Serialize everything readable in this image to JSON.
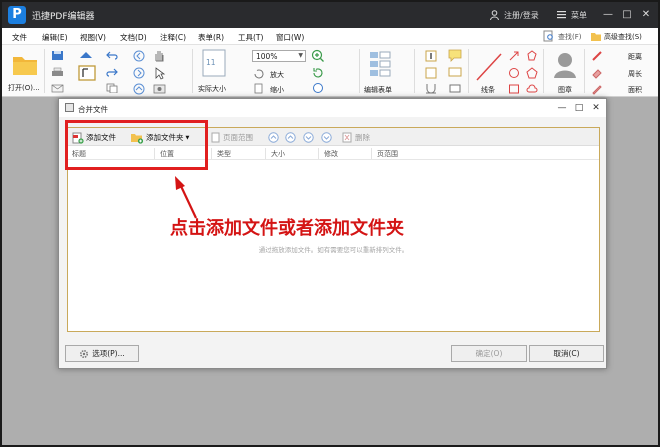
{
  "app": {
    "logo_letter": "P",
    "title": "迅捷PDF编辑器",
    "login": "注册/登录",
    "menu": "菜单"
  },
  "window_controls": {
    "minimize": "—",
    "maximize": "□",
    "close": "✕"
  },
  "menubar": [
    "文件",
    "编辑(E)",
    "视图(V)",
    "文档(D)",
    "注释(C)",
    "表单(R)",
    "工具(T)",
    "窗口(W)"
  ],
  "ribbon": {
    "open_label": "打开(O)...",
    "zoom_value": "100%",
    "actual_size": "实际大小",
    "zoom_in": "放大",
    "zoom_out": "缩小",
    "edit_form": "编辑表单",
    "line_label": "线条",
    "stamp_label": "图章",
    "find_label": "查找(F)",
    "advanced_find": "高级查找(S)",
    "distance": "距离",
    "perimeter": "周长",
    "area": "面积",
    "page_number": "11"
  },
  "dialog": {
    "title": "合并文件",
    "controls": {
      "minimize": "—",
      "maximize": "□",
      "close": "✕"
    },
    "toolbar": {
      "add_file": "添加文件",
      "add_folder": "添加文件夹",
      "page_range": "页面范围",
      "delete": "删除"
    },
    "columns": [
      "标题",
      "位置",
      "类型",
      "大小",
      "修改",
      "页范围"
    ],
    "drop_hint": "通过拖放添加文件。如有需要您可以重新排列文件。",
    "options_button": "选项(P)...",
    "ok_button": "确定(O)",
    "cancel_button": "取消(C)"
  },
  "annotation": {
    "text": "点击添加文件或者添加文件夹",
    "color": "#d41414"
  },
  "colors": {
    "titlebar": "#2a2b2e",
    "highlight": "#e11f1f",
    "panel_border": "#c9a95a",
    "workspace": "#aeaeae"
  }
}
